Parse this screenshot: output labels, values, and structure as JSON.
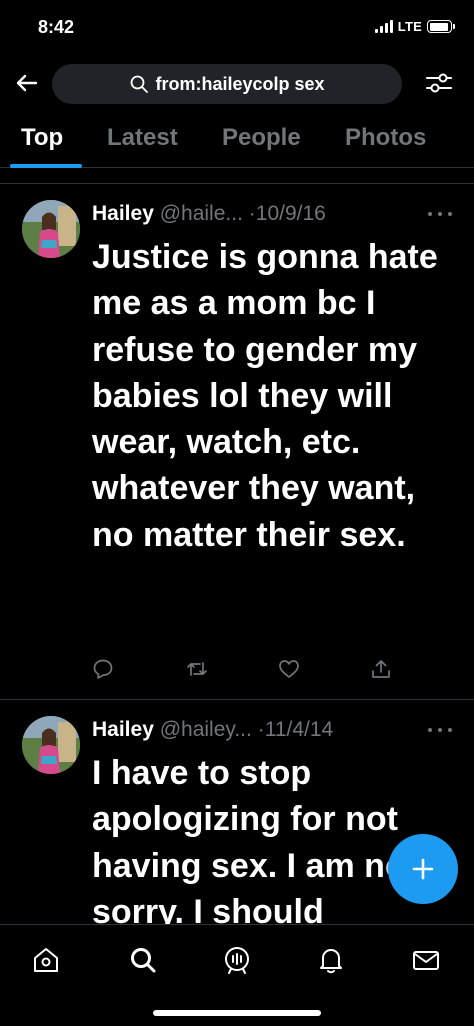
{
  "status_bar": {
    "time": "8:42",
    "network": "LTE",
    "battery_level": 0.9
  },
  "header": {
    "search_query": "from:haileycolp sex",
    "back_icon": "arrow-left-icon",
    "filter_icon": "sliders-icon"
  },
  "tabs": [
    {
      "label": "Top",
      "active": true
    },
    {
      "label": "Latest",
      "active": false
    },
    {
      "label": "People",
      "active": false
    },
    {
      "label": "Photos",
      "active": false
    }
  ],
  "tweets": [
    {
      "author": "Hailey",
      "handle": "@haile...",
      "separator": "·",
      "date": "10/9/16",
      "text": "Justice is gonna hate me as a mom bc I refuse to gender my babies lol they will wear, watch, etc. whatever they want, no matter their sex."
    },
    {
      "author": "Hailey",
      "handle": "@hailey...",
      "separator": "·",
      "date": "11/4/14",
      "text": "I have to stop apologizing for not having sex. I am not sorry. I should"
    }
  ],
  "tweet_actions": [
    "reply-icon",
    "retweet-icon",
    "like-icon",
    "share-icon"
  ],
  "compose_button": {
    "icon": "plus-icon"
  },
  "bottom_nav": [
    "home-icon",
    "search-icon",
    "spaces-icon",
    "notifications-icon",
    "messages-icon"
  ],
  "colors": {
    "background": "#000000",
    "accent": "#1d9bf0",
    "muted_text": "#71767b",
    "divider": "#2f3336",
    "search_field": "#202327"
  }
}
